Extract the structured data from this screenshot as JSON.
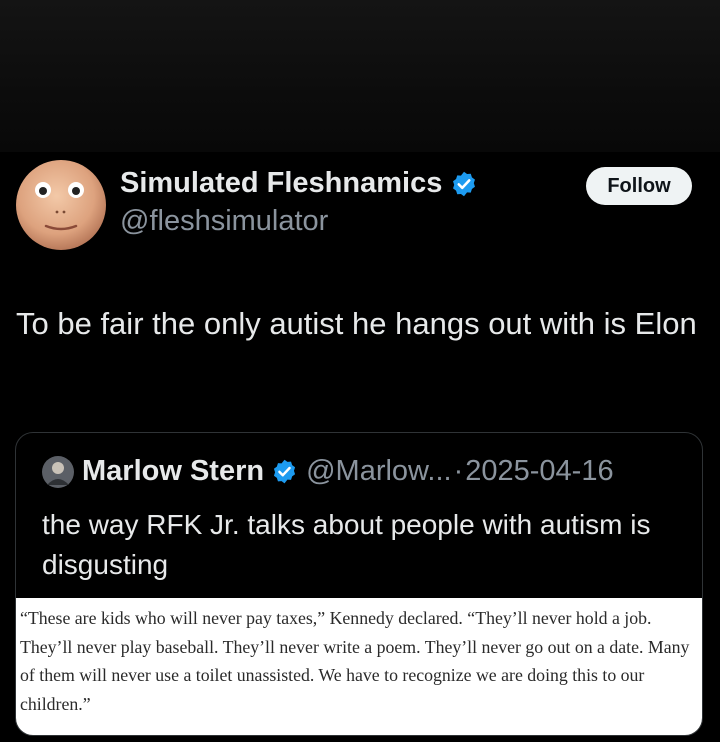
{
  "author": {
    "display_name": "Simulated Fleshnamics",
    "handle": "@fleshsimulator",
    "verified_icon": "verified-badge-icon",
    "follow_label": "Follow"
  },
  "tweet": {
    "text": "To be fair the only autist he hangs out with is Elon"
  },
  "quote": {
    "name": "Marlow Stern",
    "handle": "@Marlow...",
    "separator": "·",
    "date": "2025-04-16",
    "text": "the way RFK Jr. talks about people with autism is disgusting",
    "excerpt": "“These are kids who will never pay taxes,” Kennedy declared. “They’ll never hold a job. They’ll never play baseball. They’ll never write a poem. They’ll never go out on a date. Many of them will never use a toilet unassisted. We have to recognize we are doing this to our children.”"
  },
  "colors": {
    "background": "#000000",
    "text": "#e7e9ea",
    "muted": "#8b949e",
    "verified": "#1d9bf0",
    "follow_bg": "#eff3f4"
  }
}
